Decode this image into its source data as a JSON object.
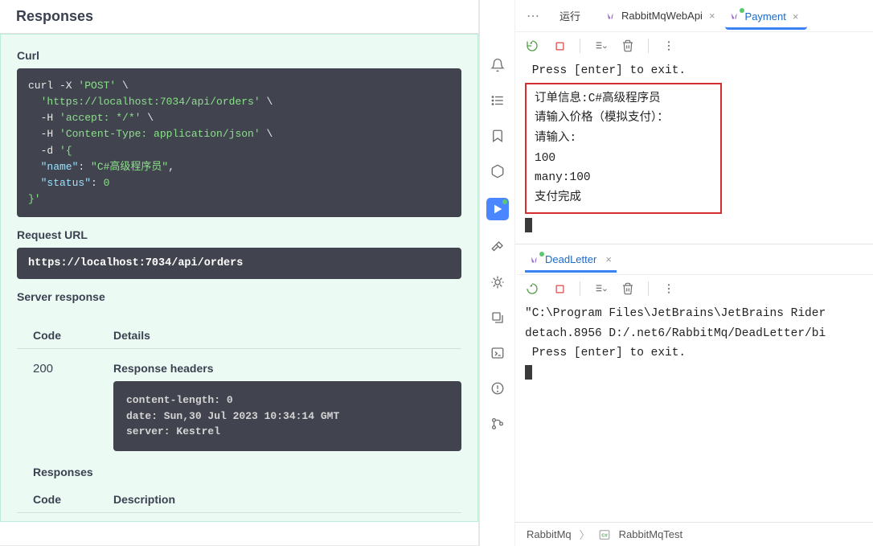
{
  "swagger": {
    "section_title": "Responses",
    "curl_label": "Curl",
    "curl_line1_cmd": "curl -X ",
    "curl_line1_str": "'POST'",
    "curl_line1_end": " \\",
    "curl_line2": "  'https://localhost:7034/api/orders'",
    "curl_line2_end": " \\",
    "curl_line3_pre": "  -H ",
    "curl_line3": "'accept: */*'",
    "curl_line3_end": " \\",
    "curl_line4_pre": "  -H ",
    "curl_line4": "'Content-Type: application/json'",
    "curl_line4_end": " \\",
    "curl_line5_pre": "  -d ",
    "curl_line5": "'{",
    "curl_line6_key": "  \"name\"",
    "curl_line6_mid": ": ",
    "curl_line6_val": "\"C#高级程序员\"",
    "curl_line6_end": ",",
    "curl_line7_key": "  \"status\"",
    "curl_line7_mid": ": ",
    "curl_line7_val": "0",
    "curl_line8": "}'",
    "request_url_label": "Request URL",
    "request_url": "https://localhost:7034/api/orders",
    "server_response_label": "Server response",
    "col_code": "Code",
    "col_details": "Details",
    "code_value": "200",
    "response_headers_label": "Response headers",
    "resp_hdr_1": " content-length: 0 ",
    "resp_hdr_2": " date: Sun,30 Jul 2023 10:34:14 GMT ",
    "resp_hdr_3": " server: Kestrel ",
    "responses_label": "Responses",
    "col_desc": "Description"
  },
  "ide": {
    "run_label": "运行",
    "tab1": "RabbitMqWebApi",
    "tab2": "Payment",
    "tab3": "DeadLetter",
    "console1_line1": " Press [enter] to exit.",
    "console1_box_l1": "订单信息:C#高级程序员",
    "console1_box_l2": "请输入价格（模拟支付）：",
    "console1_box_l3": "请输入:",
    "console1_box_l4": "100",
    "console1_box_l5": "many:100",
    "console1_box_l6": "支付完成",
    "console2_l1": "\"C:\\Program Files\\JetBrains\\JetBrains Rider",
    "console2_l2": "detach.8956 D:/.net6/RabbitMq/DeadLetter/bi",
    "console2_l3": " Press [enter] to exit.",
    "crumb1": "RabbitMq",
    "crumb2": "RabbitMqTest"
  }
}
